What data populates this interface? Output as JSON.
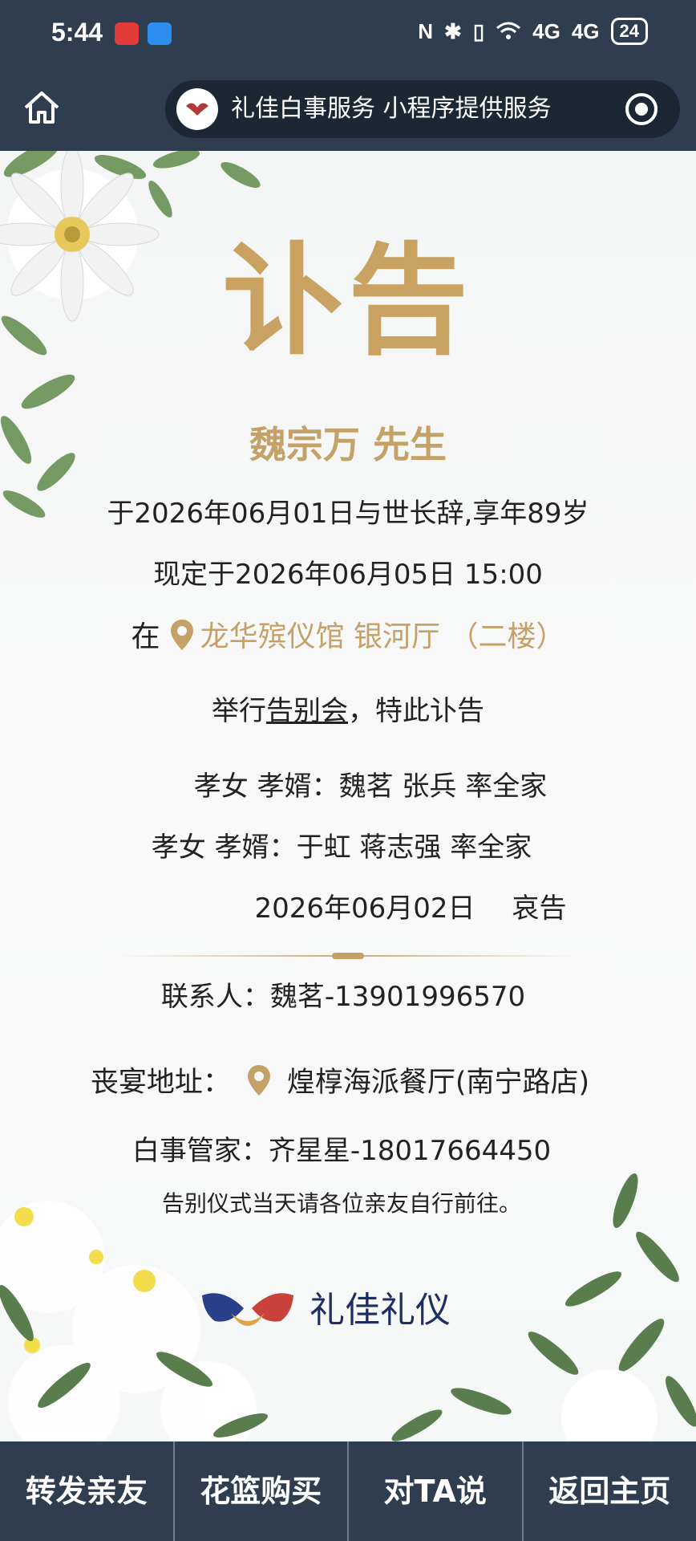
{
  "status_bar": {
    "time": "5:44",
    "battery": "24",
    "signal1": "4G",
    "signal2": "4G"
  },
  "nav": {
    "title": "礼佳白事服务 小程序提供服务"
  },
  "notice": {
    "heading": "讣告",
    "name": "魏宗万 先生",
    "line1": "于2026年06月01日与世长辞,享年89岁",
    "line2": "现定于2026年06月05日 15:00",
    "venue_prefix": "在",
    "venue": "龙华殡仪馆 银河厅 （二楼）",
    "event_prefix": "举行",
    "event_link": "告别会",
    "event_suffix": "，特此讣告",
    "family1": "孝女 孝婿：魏茗 张兵 率全家",
    "family2": "孝女 孝婿：于虹 蒋志强 率全家",
    "date": "2026年06月02日",
    "mourn": "哀告",
    "contact": "联系人：魏茗-13901996570",
    "banquet_label": "丧宴地址：",
    "banquet_address": "煌椁海派餐厅(南宁路店)",
    "steward": "白事管家：齐星星-18017664450",
    "note": "告别仪式当天请各位亲友自行前往。",
    "brand": "礼佳礼仪"
  },
  "bottom_bar": [
    "转发亲友",
    "花篮购买",
    "对TA说",
    "返回主页"
  ],
  "colors": {
    "gold": "#c4a166",
    "bar": "#2f3d51",
    "brand": "#1e2e63"
  }
}
